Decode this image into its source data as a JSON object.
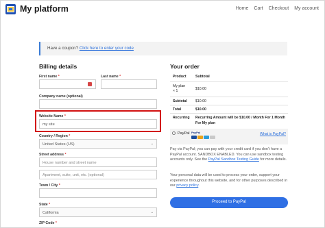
{
  "header": {
    "brand": "My platform",
    "nav": [
      "Home",
      "Cart",
      "Checkout",
      "My account"
    ]
  },
  "coupon": {
    "prompt": "Have a coupon?",
    "link": "Click here to enter your code"
  },
  "billing": {
    "title": "Billing details",
    "first_name_label": "First name",
    "last_name_label": "Last name",
    "company_label": "Company name (optional)",
    "website_label": "Website Name",
    "website_value": "my site",
    "country_label": "Country / Region",
    "country_value": "United States (US)",
    "street_label": "Street address",
    "street_placeholder": "House number and street name",
    "apartment_placeholder": "Apartment, suite, unit, etc. (optional)",
    "city_label": "Town / City",
    "state_label": "State",
    "state_value": "California",
    "zip_label": "ZIP Code",
    "required_mark": "*"
  },
  "order": {
    "title": "Your order",
    "col_product": "Product",
    "col_subtotal": "Subtotal",
    "item_name": "My plan",
    "item_qty": "× 1",
    "item_price": "$10.00",
    "subtotal_label": "Subtotal",
    "subtotal_value": "$10.00",
    "total_label": "Total",
    "total_value": "$10.00",
    "recurring_label": "Recurring",
    "recurring_value": "Recurring Amount will be $10.00 / Month For 1 Month For My plan"
  },
  "payment": {
    "method": "PayPal",
    "logo_text": "PayPal",
    "what_link": "What is PayPal?",
    "desc_text": "Pay via PayPal; you can pay with your credit card if you don't have a PayPal account. SANDBOX ENABLED. You can use sandbox testing accounts only. See the",
    "desc_link": "PayPal Sandbox Testing Guide",
    "desc_after": "for more details.",
    "privacy_text": "Your personal data will be used to process your order, support your experience throughout this website, and for other purposes described in our",
    "privacy_link": "privacy policy",
    "privacy_after": ".",
    "button": "Proceed to PayPal"
  },
  "colors": {
    "accent": "#2f6fe4",
    "highlight": "#d20f0f",
    "required": "#d33333"
  }
}
